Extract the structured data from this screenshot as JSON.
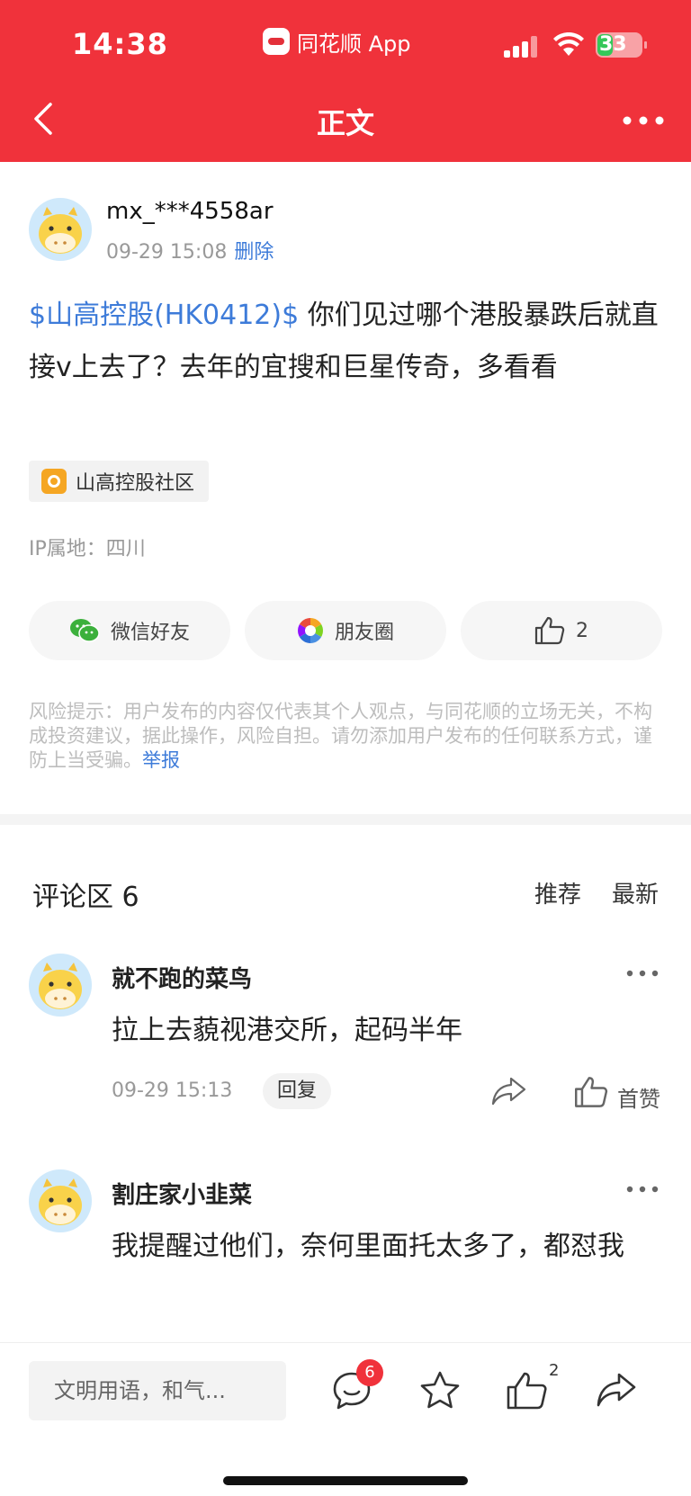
{
  "status_bar": {
    "time": "14:38",
    "app_name": "同花顺 App",
    "battery": "33"
  },
  "nav": {
    "title": "正文"
  },
  "post": {
    "author": "mx_***4558ar",
    "date": "09-29 15:08",
    "delete_label": "删除",
    "stock_tag": "$山高控股(HK0412)$",
    "text": " 你们见过哪个港股暴跌后就直接v上去了？去年的宜搜和巨星传奇，多看看",
    "community": "山高控股社区",
    "ip": "IP属地：四川"
  },
  "share": {
    "wechat": "微信好友",
    "moments": "朋友圈",
    "likes": "2"
  },
  "risk": {
    "text": "风险提示：用户发布的内容仅代表其个人观点，与同花顺的立场无关，不构成投资建议，据此操作，风险自担。请勿添加用户发布的任何联系方式，谨防上当受骗。",
    "report": "举报"
  },
  "comments_header": {
    "title": "评论区 6",
    "tab_recommend": "推荐",
    "tab_latest": "最新"
  },
  "comments": [
    {
      "name": "就不跑的菜鸟",
      "text": "拉上去藐视港交所，起码半年",
      "time": "09-29 15:13",
      "reply": "回复",
      "like": "首赞"
    },
    {
      "name": "割庄家小韭菜",
      "text": "我提醒过他们，奈何里面托太多了，都怼我"
    }
  ],
  "bottom_bar": {
    "input_placeholder": "文明用语，和气...",
    "comment_badge": "6",
    "like_count": "2"
  },
  "colors": {
    "brand_red": "#f0323b",
    "link_blue": "#3d7bd9"
  }
}
